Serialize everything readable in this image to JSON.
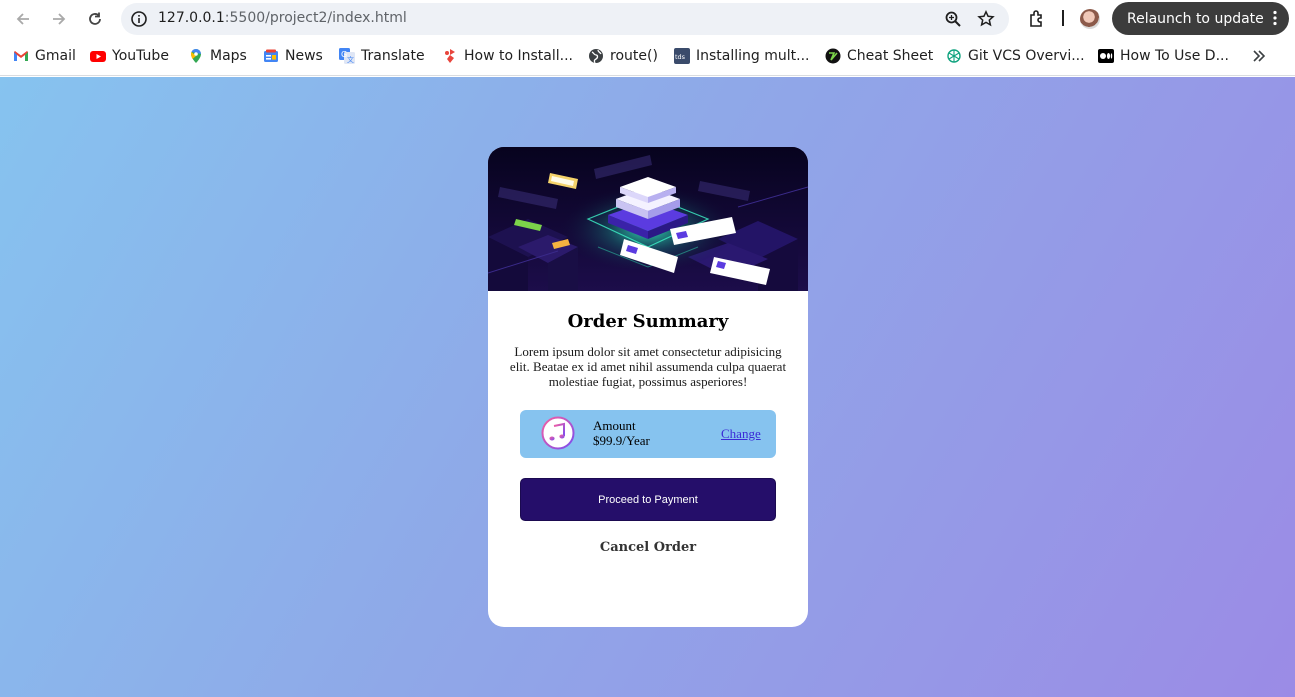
{
  "browser": {
    "url_host": "127.0.0.1",
    "url_rest": ":5500/project2/index.html",
    "relaunch_label": "Relaunch to update"
  },
  "bookmarks": [
    {
      "label": "Gmail",
      "icon": "gmail-icon"
    },
    {
      "label": "YouTube",
      "icon": "youtube-icon"
    },
    {
      "label": "Maps",
      "icon": "maps-icon"
    },
    {
      "label": "News",
      "icon": "news-icon"
    },
    {
      "label": "Translate",
      "icon": "translate-icon"
    },
    {
      "label": "How to Install...",
      "icon": "bookmark-site-icon"
    },
    {
      "label": "route()",
      "icon": "globe-icon"
    },
    {
      "label": "Installing mult...",
      "icon": "tds-icon"
    },
    {
      "label": "Cheat Sheet",
      "icon": "cheatsheet-icon"
    },
    {
      "label": "Git VCS Overvi...",
      "icon": "openai-icon"
    },
    {
      "label": "How To Use D...",
      "icon": "medium-icon"
    }
  ],
  "card": {
    "title": "Order Summary",
    "description": "Lorem ipsum dolor sit amet consectetur adipisicing elit. Beatae ex id amet nihil assumenda culpa quaerat molestiae fugiat, possimus asperiores!",
    "plan": {
      "amount_label": "Amount",
      "amount_value": "$99.9/Year",
      "change_label": "Change"
    },
    "proceed_label": "Proceed to Payment",
    "cancel_label": "Cancel Order"
  }
}
